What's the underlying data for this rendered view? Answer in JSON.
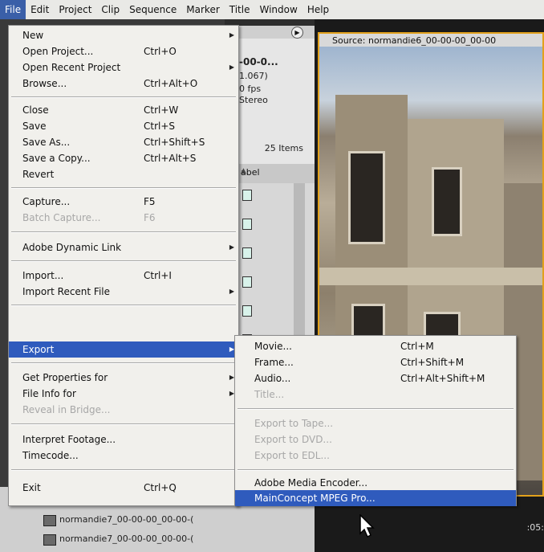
{
  "menubar": {
    "items": [
      "File",
      "Edit",
      "Project",
      "Clip",
      "Sequence",
      "Marker",
      "Title",
      "Window",
      "Help"
    ]
  },
  "project_panel": {
    "name_fragment": "-00-0...",
    "fps_fragment_1": "1.067)",
    "fps_fragment_2": "0 fps",
    "audio_fragment": "Stereo",
    "items_count": "25 Items",
    "label_header": "abel"
  },
  "source_panel": {
    "tab_title": "Source: normandie6_00-00-00_00-00",
    "timecode_fragment": ":05:"
  },
  "bottom_rows": [
    "normandie7_00-00-00_00-00-(",
    "normandie7_00-00-00_00-00-("
  ],
  "file_menu": {
    "items": [
      {
        "label": "New",
        "shortcut": "",
        "submenu": true,
        "disabled": false
      },
      {
        "label": "Open Project...",
        "shortcut": "Ctrl+O",
        "submenu": false,
        "disabled": false
      },
      {
        "label": "Open Recent Project",
        "shortcut": "",
        "submenu": true,
        "disabled": false
      },
      {
        "label": "Browse...",
        "shortcut": "Ctrl+Alt+O",
        "submenu": false,
        "disabled": false
      },
      {
        "label": "Close",
        "shortcut": "Ctrl+W",
        "submenu": false,
        "disabled": false
      },
      {
        "label": "Save",
        "shortcut": "Ctrl+S",
        "submenu": false,
        "disabled": false
      },
      {
        "label": "Save As...",
        "shortcut": "Ctrl+Shift+S",
        "submenu": false,
        "disabled": false
      },
      {
        "label": "Save a Copy...",
        "shortcut": "Ctrl+Alt+S",
        "submenu": false,
        "disabled": false
      },
      {
        "label": "Revert",
        "shortcut": "",
        "submenu": false,
        "disabled": false
      },
      {
        "label": "Capture...",
        "shortcut": "F5",
        "submenu": false,
        "disabled": false
      },
      {
        "label": "Batch Capture...",
        "shortcut": "F6",
        "submenu": false,
        "disabled": true
      },
      {
        "label": "Adobe Dynamic Link",
        "shortcut": "",
        "submenu": true,
        "disabled": false
      },
      {
        "label": "Import...",
        "shortcut": "Ctrl+I",
        "submenu": false,
        "disabled": false
      },
      {
        "label": "Import Recent File",
        "shortcut": "",
        "submenu": true,
        "disabled": false
      },
      {
        "label": "Export",
        "shortcut": "",
        "submenu": true,
        "disabled": false,
        "highlighted": true
      },
      {
        "label": "Get Properties for",
        "shortcut": "",
        "submenu": true,
        "disabled": false
      },
      {
        "label": "File Info for",
        "shortcut": "",
        "submenu": true,
        "disabled": false
      },
      {
        "label": "Reveal in Bridge...",
        "shortcut": "",
        "submenu": false,
        "disabled": true
      },
      {
        "label": "Interpret Footage...",
        "shortcut": "",
        "submenu": false,
        "disabled": false
      },
      {
        "label": "Timecode...",
        "shortcut": "",
        "submenu": false,
        "disabled": false
      },
      {
        "label": "Exit",
        "shortcut": "Ctrl+Q",
        "submenu": false,
        "disabled": false
      }
    ]
  },
  "export_menu": {
    "items": [
      {
        "label": "Movie...",
        "shortcut": "Ctrl+M",
        "disabled": false
      },
      {
        "label": "Frame...",
        "shortcut": "Ctrl+Shift+M",
        "disabled": false
      },
      {
        "label": "Audio...",
        "shortcut": "Ctrl+Alt+Shift+M",
        "disabled": false
      },
      {
        "label": "Title...",
        "shortcut": "",
        "disabled": true
      },
      {
        "label": "Export to Tape...",
        "shortcut": "",
        "disabled": true
      },
      {
        "label": "Export to DVD...",
        "shortcut": "",
        "disabled": true
      },
      {
        "label": "Export to EDL...",
        "shortcut": "",
        "disabled": true
      },
      {
        "label": "Adobe Media Encoder...",
        "shortcut": "",
        "disabled": false
      },
      {
        "label": "MainConcept MPEG Pro...",
        "shortcut": "",
        "disabled": false,
        "highlighted": true
      }
    ]
  },
  "colors": {
    "menu_bg": "#f1f0ec",
    "highlight": "#2f5bbd",
    "menubar_bg": "#e9e9e6",
    "panel_border": "#e2a11c"
  }
}
